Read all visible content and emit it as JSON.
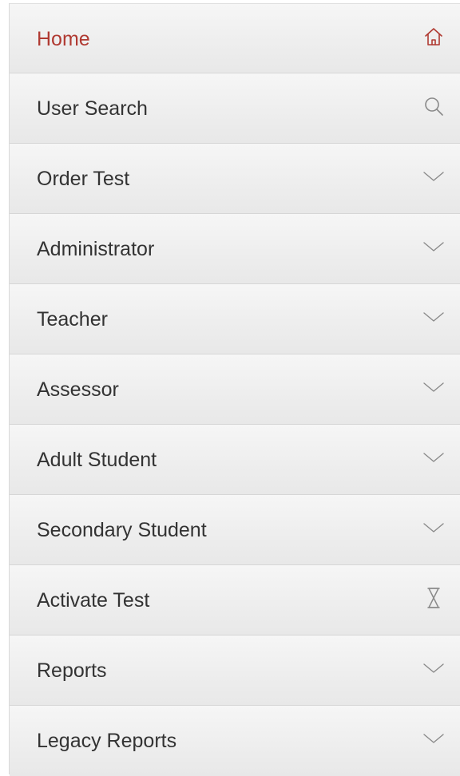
{
  "nav": {
    "items": [
      {
        "label": "Home",
        "icon": "home-icon",
        "active": true
      },
      {
        "label": "User Search",
        "icon": "search-icon",
        "active": false
      },
      {
        "label": "Order Test",
        "icon": "chevron-down-icon",
        "active": false
      },
      {
        "label": "Administrator",
        "icon": "chevron-down-icon",
        "active": false
      },
      {
        "label": "Teacher",
        "icon": "chevron-down-icon",
        "active": false
      },
      {
        "label": "Assessor",
        "icon": "chevron-down-icon",
        "active": false
      },
      {
        "label": "Adult Student",
        "icon": "chevron-down-icon",
        "active": false
      },
      {
        "label": "Secondary Student",
        "icon": "chevron-down-icon",
        "active": false
      },
      {
        "label": "Activate Test",
        "icon": "hourglass-icon",
        "active": false
      },
      {
        "label": "Reports",
        "icon": "chevron-down-icon",
        "active": false
      },
      {
        "label": "Legacy Reports",
        "icon": "chevron-down-icon",
        "active": false
      }
    ]
  },
  "colors": {
    "active_text": "#b03a32",
    "text": "#333333",
    "icon": "#8a8a8a"
  }
}
